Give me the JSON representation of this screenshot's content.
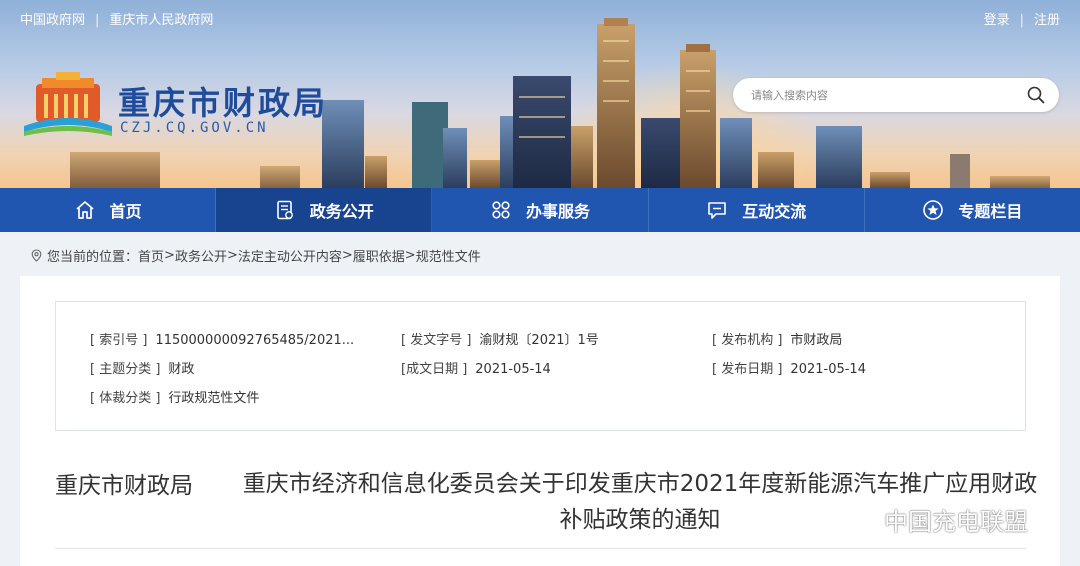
{
  "header": {
    "top_links": [
      "中国政府网",
      "重庆市人民政府网"
    ],
    "separator": "|",
    "user_links": [
      "登录",
      "注册"
    ],
    "site_title": "重庆市财政局",
    "site_domain": "CZJ.CQ.GOV.CN",
    "search_placeholder": "请输入搜索内容"
  },
  "nav": {
    "items": [
      {
        "label": "首页",
        "icon": "home-icon"
      },
      {
        "label": "政务公开",
        "icon": "document-icon"
      },
      {
        "label": "办事服务",
        "icon": "grid-icon"
      },
      {
        "label": "互动交流",
        "icon": "message-icon"
      },
      {
        "label": "专题栏目",
        "icon": "star-icon"
      }
    ],
    "active_index": 1
  },
  "breadcrumb": {
    "prefix": "您当前的位置：",
    "items": [
      "首页",
      "政务公开",
      "法定主动公开内容",
      "履职依据",
      "规范性文件"
    ],
    "separator": ">"
  },
  "meta": {
    "index_no": {
      "label": "[ 索引号 ]",
      "value": "115000000092765485/2021..."
    },
    "doc_no": {
      "label": "[ 发文字号 ]",
      "value": "渝财规〔2021〕1号"
    },
    "publisher": {
      "label": "[ 发布机构 ]",
      "value": "市财政局"
    },
    "subject": {
      "label": "[ 主题分类 ]",
      "value": "财政"
    },
    "written_date": {
      "label": "[成文日期 ]",
      "value": "2021-05-14"
    },
    "publish_date": {
      "label": "[ 发布日期 ]",
      "value": "2021-05-14"
    },
    "genre": {
      "label": "[ 体裁分类 ]",
      "value": "行政规范性文件"
    }
  },
  "document": {
    "org": "重庆市财政局",
    "title": "重庆市经济和信息化委员会关于印发重庆市2021年度新能源汽车推广应用财政补贴政策的通知"
  },
  "watermark": "中国充电联盟",
  "colors": {
    "nav_bg": "#2055b0",
    "nav_active": "#18448f",
    "title_blue": "#1f4c9a",
    "page_bg": "#eef2f7"
  }
}
